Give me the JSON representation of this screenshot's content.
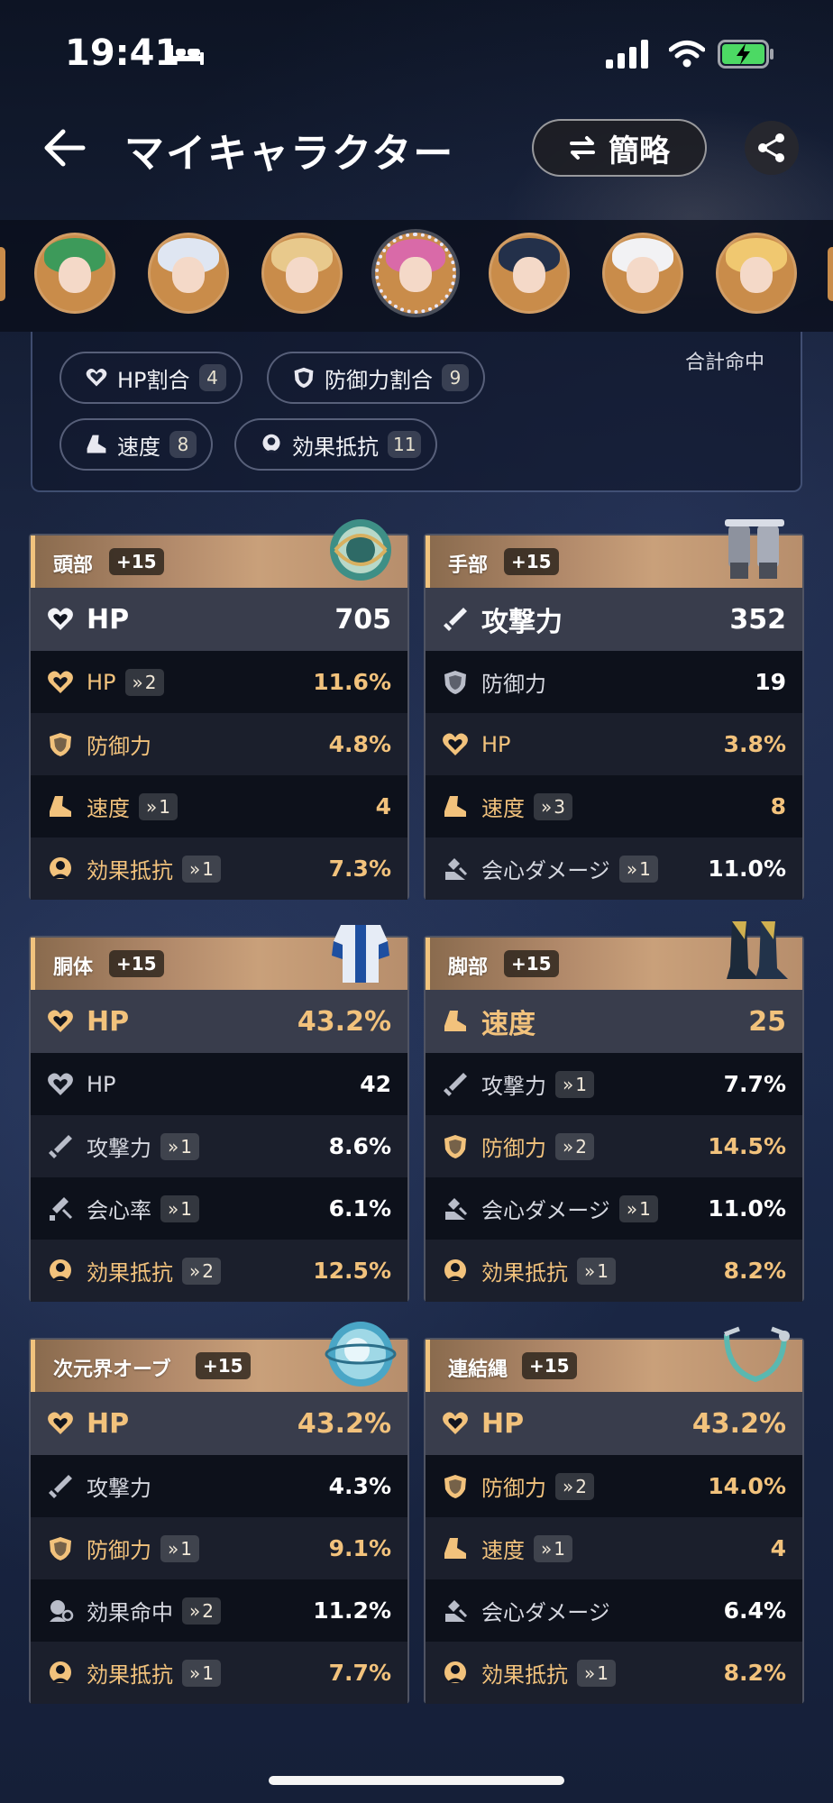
{
  "status_bar": {
    "time": "19:41"
  },
  "header": {
    "title": "マイキャラクター",
    "simple_label": "簡略"
  },
  "set_effects": {
    "label": "合計命中",
    "chips": [
      {
        "name": "HP割合",
        "count": "4",
        "icon": "heart-icon"
      },
      {
        "name": "防御力割合",
        "count": "9",
        "icon": "shield-icon"
      },
      {
        "name": "速度",
        "count": "8",
        "icon": "boot-icon"
      },
      {
        "name": "効果抵抗",
        "count": "11",
        "icon": "resist-icon"
      }
    ]
  },
  "colors": {
    "gold": "#f2c27c",
    "card_header": "#b1896a"
  },
  "relics": [
    {
      "slot": "頭部",
      "level": "+15",
      "main": {
        "label": "HP",
        "value": "705",
        "icon": "heart-icon",
        "gold": false
      },
      "subs": [
        {
          "label": "HP",
          "roll": "2",
          "value": "11.6%",
          "icon": "heart-icon",
          "gold": true
        },
        {
          "label": "防御力",
          "roll": "",
          "value": "4.8%",
          "icon": "shield-icon",
          "gold": true
        },
        {
          "label": "速度",
          "roll": "1",
          "value": "4",
          "icon": "boot-icon",
          "gold": true
        },
        {
          "label": "効果抵抗",
          "roll": "1",
          "value": "7.3%",
          "icon": "resist-icon",
          "gold": true
        }
      ]
    },
    {
      "slot": "手部",
      "level": "+15",
      "main": {
        "label": "攻撃力",
        "value": "352",
        "icon": "sword-icon",
        "gold": false
      },
      "subs": [
        {
          "label": "防御力",
          "roll": "",
          "value": "19",
          "icon": "shield-icon",
          "gold": false
        },
        {
          "label": "HP",
          "roll": "",
          "value": "3.8%",
          "icon": "heart-icon",
          "gold": true
        },
        {
          "label": "速度",
          "roll": "3",
          "value": "8",
          "icon": "boot-icon",
          "gold": true
        },
        {
          "label": "会心ダメージ",
          "roll": "1",
          "value": "11.0%",
          "icon": "crit-dmg-icon",
          "gold": false
        }
      ]
    },
    {
      "slot": "胴体",
      "level": "+15",
      "main": {
        "label": "HP",
        "value": "43.2%",
        "icon": "heart-icon",
        "gold": true
      },
      "subs": [
        {
          "label": "HP",
          "roll": "",
          "value": "42",
          "icon": "heart-icon",
          "gold": false
        },
        {
          "label": "攻撃力",
          "roll": "1",
          "value": "8.6%",
          "icon": "sword-icon",
          "gold": false
        },
        {
          "label": "会心率",
          "roll": "1",
          "value": "6.1%",
          "icon": "crit-rate-icon",
          "gold": false
        },
        {
          "label": "効果抵抗",
          "roll": "2",
          "value": "12.5%",
          "icon": "resist-icon",
          "gold": true
        }
      ]
    },
    {
      "slot": "脚部",
      "level": "+15",
      "main": {
        "label": "速度",
        "value": "25",
        "icon": "boot-icon",
        "gold": true
      },
      "subs": [
        {
          "label": "攻撃力",
          "roll": "1",
          "value": "7.7%",
          "icon": "sword-icon",
          "gold": false
        },
        {
          "label": "防御力",
          "roll": "2",
          "value": "14.5%",
          "icon": "shield-icon",
          "gold": true
        },
        {
          "label": "会心ダメージ",
          "roll": "1",
          "value": "11.0%",
          "icon": "crit-dmg-icon",
          "gold": false
        },
        {
          "label": "効果抵抗",
          "roll": "1",
          "value": "8.2%",
          "icon": "resist-icon",
          "gold": true
        }
      ]
    },
    {
      "slot": "次元界オーブ",
      "level": "+15",
      "main": {
        "label": "HP",
        "value": "43.2%",
        "icon": "heart-icon",
        "gold": true
      },
      "subs": [
        {
          "label": "攻撃力",
          "roll": "",
          "value": "4.3%",
          "icon": "sword-icon",
          "gold": false
        },
        {
          "label": "防御力",
          "roll": "1",
          "value": "9.1%",
          "icon": "shield-icon",
          "gold": true
        },
        {
          "label": "効果命中",
          "roll": "2",
          "value": "11.2%",
          "icon": "effect-hit-icon",
          "gold": false
        },
        {
          "label": "効果抵抗",
          "roll": "1",
          "value": "7.7%",
          "icon": "resist-icon",
          "gold": true
        }
      ]
    },
    {
      "slot": "連結縄",
      "level": "+15",
      "main": {
        "label": "HP",
        "value": "43.2%",
        "icon": "heart-icon",
        "gold": true
      },
      "subs": [
        {
          "label": "防御力",
          "roll": "2",
          "value": "14.0%",
          "icon": "shield-icon",
          "gold": true
        },
        {
          "label": "速度",
          "roll": "1",
          "value": "4",
          "icon": "boot-icon",
          "gold": true
        },
        {
          "label": "会心ダメージ",
          "roll": "",
          "value": "6.4%",
          "icon": "crit-dmg-icon",
          "gold": false
        },
        {
          "label": "効果抵抗",
          "roll": "1",
          "value": "8.2%",
          "icon": "resist-icon",
          "gold": true
        }
      ]
    }
  ]
}
